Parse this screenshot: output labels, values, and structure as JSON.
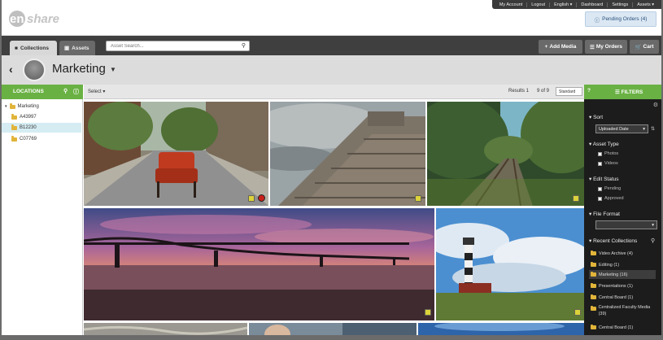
{
  "topnav": {
    "items": [
      "My Account",
      "Logout",
      "English ▾",
      "Dashboard",
      "Settings",
      "Assets ▾"
    ]
  },
  "logo_text": "enshare",
  "pending_orders": "Pending Orders (4)",
  "tabs": {
    "collections": "Collections",
    "assets": "Assets"
  },
  "search": {
    "placeholder": "Asset Search..."
  },
  "toolbar": {
    "add_media": "Add Media",
    "my_orders": "My Orders",
    "cart": "Cart"
  },
  "collection": {
    "title": "Marketing"
  },
  "left_panel": {
    "title": "LOCATIONS",
    "tree": [
      {
        "label": "Marketing",
        "level": 0,
        "selected": false
      },
      {
        "label": "A43997",
        "level": 1,
        "selected": false
      },
      {
        "label": "B12230",
        "level": 1,
        "selected": true
      },
      {
        "label": "C07769",
        "level": 1,
        "selected": false
      }
    ]
  },
  "grid_header": {
    "select_label": "Select ▾",
    "results": "Results 1",
    "of": "9 of 9",
    "sort_value": "Standard"
  },
  "filters": {
    "title": "FILTERS",
    "sort": {
      "heading": "Sort",
      "value": "Uploaded Date"
    },
    "asset_type": {
      "heading": "Asset Type",
      "options": [
        "Photos",
        "Videos"
      ]
    },
    "edit_status": {
      "heading": "Edit Status",
      "options": [
        "Pending",
        "Approved"
      ]
    },
    "file_format": {
      "heading": "File Format",
      "value": ""
    },
    "recent": {
      "heading": "Recent Collections",
      "items": [
        "Video Archive (4)",
        "Editing (1)",
        "Marketing (16)",
        "Presentations (1)",
        "Central Board (1)",
        "Centralized Faculty Media (39)",
        "Central Board (1)"
      ],
      "active_index": 2
    }
  },
  "colors": {
    "green": "#6ab144",
    "dark": "#3f3f3f",
    "panel": "#1c1c1c",
    "folder": "#e1b43a"
  }
}
